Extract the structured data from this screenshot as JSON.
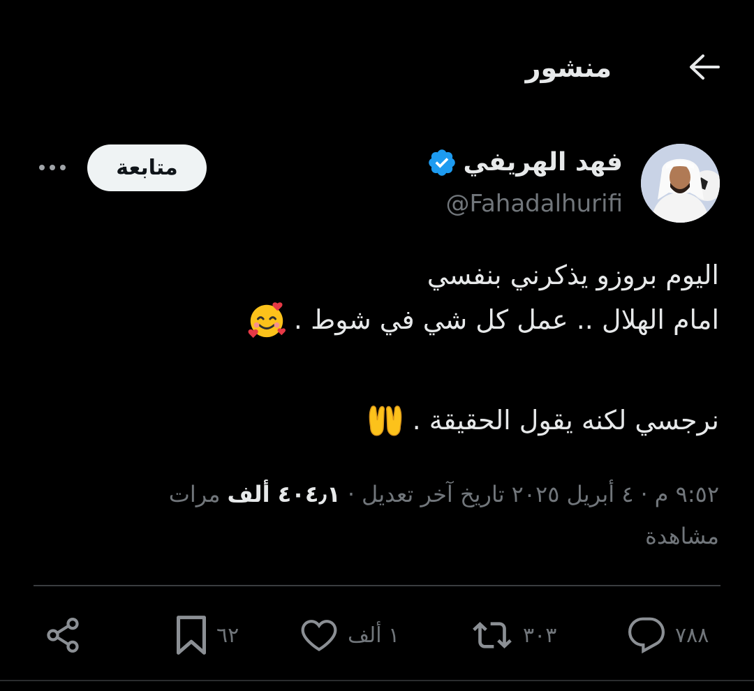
{
  "header": {
    "title": "منشور",
    "back_icon": "arrow-left-icon"
  },
  "author": {
    "name": "فهد الهريفي",
    "handle": "@Fahadalhurifi",
    "verified": true,
    "verified_color": "#1d9bf0",
    "follow_label": "متابعة",
    "more_icon": "more-dots-icon"
  },
  "tweet": {
    "lines": [
      {
        "text": "اليوم بروزو يذكرني بنفسي"
      },
      {
        "text": "امام الهلال .. عمل كل شي في شوط .",
        "emoji": "smiling-face-with-hearts-icon"
      },
      {
        "text": "نرجسي لكنه يقول الحقيقة .",
        "emoji": "palms-up-together-icon"
      }
    ]
  },
  "meta": {
    "time": "٩:٥٢ م",
    "date": "٤ أبريل ٢٠٢٥",
    "edited_label": "تاريخ آخر تعديل",
    "separator": "·",
    "views_value": "٤٠٤٫١ ألف",
    "views_label": "مرات مشاهدة",
    "views_label_part1": "مرات",
    "views_label_part2": "مشاهدة"
  },
  "actions": {
    "reply": {
      "count": "٧٨٨",
      "icon": "reply-icon"
    },
    "retweet": {
      "count": "٣٠٣",
      "icon": "retweet-icon"
    },
    "like": {
      "count": "١ ألف",
      "icon": "heart-icon"
    },
    "bookmark": {
      "count": "٦٢",
      "icon": "bookmark-icon"
    },
    "share": {
      "icon": "share-icon"
    }
  },
  "colors": {
    "background": "#000000",
    "text": "#e7e9ea",
    "muted": "#71767b",
    "accent": "#1d9bf0"
  }
}
